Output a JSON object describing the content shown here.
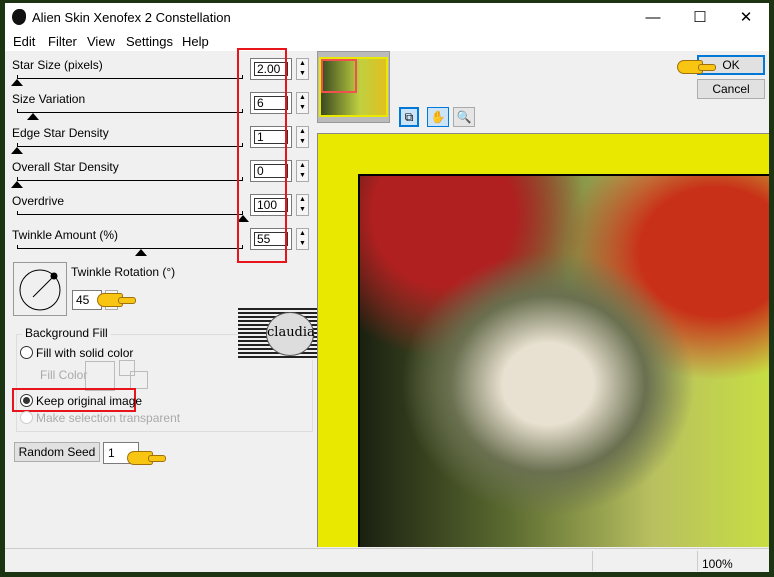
{
  "window": {
    "title": "Alien Skin Xenofex 2 Constellation",
    "controls": {
      "minimize": "—",
      "maximize": "☐",
      "close": "✕"
    }
  },
  "menu": [
    "Edit",
    "Filter",
    "View",
    "Settings",
    "Help"
  ],
  "sliders": [
    {
      "label": "Star Size (pixels)",
      "value": "2.00",
      "fraction": 0.0
    },
    {
      "label": "Size Variation",
      "value": "6",
      "fraction": 0.07
    },
    {
      "label": "Edge Star Density",
      "value": "1",
      "fraction": 0.0
    },
    {
      "label": "Overall Star Density",
      "value": "0",
      "fraction": 0.0
    },
    {
      "label": "Overdrive",
      "value": "100",
      "fraction": 1.0
    },
    {
      "label": "Twinkle Amount (%)",
      "value": "55",
      "fraction": 0.55
    }
  ],
  "twinkle_rotation": {
    "label": "Twinkle Rotation (°)",
    "value": "45"
  },
  "background_fill": {
    "label": "Background Fill",
    "options": [
      "Fill with solid color",
      "Keep original image",
      "Make selection transparent"
    ],
    "selected": "Keep original image",
    "fill_color_label": "Fill Color"
  },
  "random_seed": {
    "label": "Random Seed",
    "value": "1"
  },
  "buttons": {
    "ok": "OK",
    "cancel": "Cancel"
  },
  "watermark": "claudia",
  "status": {
    "zoom": "100%"
  },
  "colors": {
    "highlight": "#e8141c",
    "preview_bg": "#e8e800",
    "accent": "#0078d7"
  }
}
